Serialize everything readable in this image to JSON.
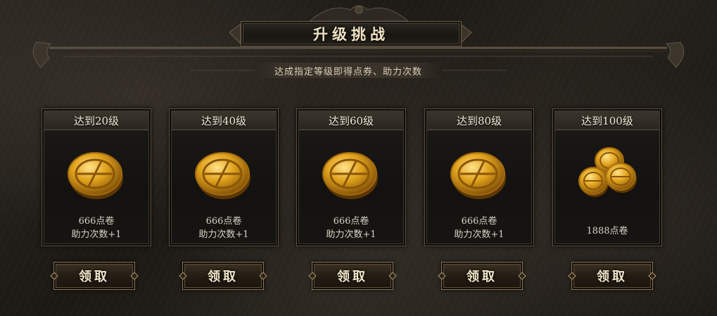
{
  "header": {
    "title": "升级挑战",
    "subtitle": "达成指定等级即得点券、助力次数"
  },
  "cards": [
    {
      "title": "达到20级",
      "reward_line1": "666点卷",
      "reward_line2": "助力次数+1",
      "button": "领取",
      "coin_icon": "single-gold-coin"
    },
    {
      "title": "达到40级",
      "reward_line1": "666点卷",
      "reward_line2": "助力次数+1",
      "button": "领取",
      "coin_icon": "single-gold-coin"
    },
    {
      "title": "达到60级",
      "reward_line1": "666点卷",
      "reward_line2": "助力次数+1",
      "button": "领取",
      "coin_icon": "single-gold-coin"
    },
    {
      "title": "达到80级",
      "reward_line1": "666点卷",
      "reward_line2": "助力次数+1",
      "button": "领取",
      "coin_icon": "single-gold-coin"
    },
    {
      "title": "达到100级",
      "reward_line1": "1888点卷",
      "reward_line2": "",
      "button": "领取",
      "coin_icon": "gold-coin-stack"
    }
  ],
  "colors": {
    "gold": "#e0a21c",
    "frame": "#5a5043",
    "text": "#f2ead8"
  }
}
